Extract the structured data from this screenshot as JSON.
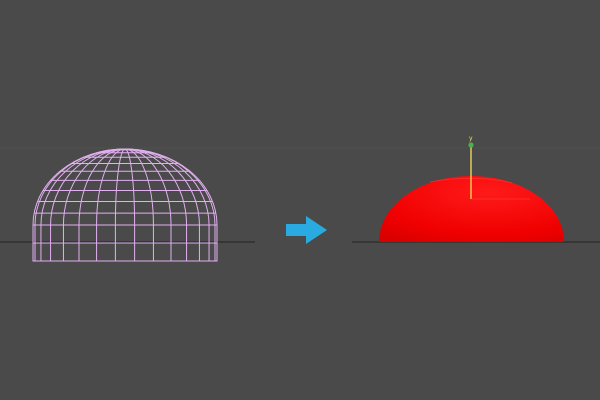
{
  "viewport": {
    "background_color": "#4a4a4a",
    "horizon_color": "#2a2a2a",
    "ground_plane_color": "#505050"
  },
  "left_view": {
    "object": "hemisphere",
    "display_mode": "wireframe",
    "wire_color": "#e2b0f0",
    "latitude_segments": 10,
    "longitude_segments": 15
  },
  "arrow": {
    "icon": "arrow-right-icon",
    "color": "#29abe2"
  },
  "right_view": {
    "object": "flattened-hemisphere",
    "display_mode": "shaded",
    "fill_color": "#ff0000",
    "gizmo": {
      "axis_label": "y",
      "axis_color": "#f5e15a",
      "pivot_color": "#4caf50"
    }
  }
}
